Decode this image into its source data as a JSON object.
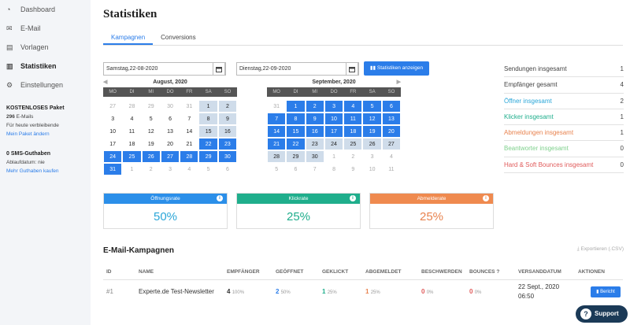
{
  "sidebar": {
    "items": [
      {
        "label": "Dashboard",
        "icon": "dashboard-icon"
      },
      {
        "label": "E-Mail",
        "icon": "email-icon"
      },
      {
        "label": "Vorlagen",
        "icon": "templates-icon"
      },
      {
        "label": "Statistiken",
        "icon": "chart-icon",
        "active": true
      },
      {
        "label": "Einstellungen",
        "icon": "gear-icon"
      }
    ],
    "package": {
      "head": "KOSTENLOSES Paket",
      "count": "296",
      "count_label": " E-Mails",
      "note": "Für heute verbleibende",
      "link": "Mein Paket ändern"
    },
    "sms": {
      "head": "0 SMS-Guthaben",
      "note": "Ablaufdatum: nie",
      "link": "Mehr Guthaben kaufen"
    }
  },
  "page": {
    "title": "Statistiken",
    "tabs": [
      "Kampagnen",
      "Conversions"
    ]
  },
  "filters": {
    "from": "Samstag,22-08-2020",
    "to": "Dienstag,22-09-2020",
    "button": "Statistiken anzeigen"
  },
  "calendars": [
    {
      "title": "August, 2020",
      "days": [
        [
          "27",
          "28",
          "29",
          "30",
          "31",
          "1",
          "2"
        ],
        [
          "3",
          "4",
          "5",
          "6",
          "7",
          "8",
          "9"
        ],
        [
          "10",
          "11",
          "12",
          "13",
          "14",
          "15",
          "16"
        ],
        [
          "17",
          "18",
          "19",
          "20",
          "21",
          "22",
          "23"
        ],
        [
          "24",
          "25",
          "26",
          "27",
          "28",
          "29",
          "30"
        ],
        [
          "31",
          "1",
          "2",
          "3",
          "4",
          "5",
          "6"
        ]
      ]
    },
    {
      "title": "September, 2020",
      "days": [
        [
          "31",
          "1",
          "2",
          "3",
          "4",
          "5",
          "6"
        ],
        [
          "7",
          "8",
          "9",
          "10",
          "11",
          "12",
          "13"
        ],
        [
          "14",
          "15",
          "16",
          "17",
          "18",
          "19",
          "20"
        ],
        [
          "21",
          "22",
          "23",
          "24",
          "25",
          "26",
          "27"
        ],
        [
          "28",
          "29",
          "30",
          "1",
          "2",
          "3",
          "4"
        ],
        [
          "5",
          "6",
          "7",
          "8",
          "9",
          "10",
          "11"
        ]
      ]
    }
  ],
  "weekdays": [
    "MO",
    "DI",
    "MI",
    "DO",
    "FR",
    "SA",
    "SO"
  ],
  "stats": [
    {
      "label": "Sendungen insgesamt",
      "value": "1",
      "color": "#444444"
    },
    {
      "label": "Empfänger gesamt",
      "value": "4",
      "color": "#444444"
    },
    {
      "label": "Öffner insgesamt",
      "value": "2",
      "color": "#2aa6d8"
    },
    {
      "label": "Klicker insgesamt",
      "value": "1",
      "color": "#1fae8c"
    },
    {
      "label": "Abmeldungen insgesamt",
      "value": "1",
      "color": "#e8834f"
    },
    {
      "label": "Beantworter insgesamt",
      "value": "0",
      "color": "#7ed08c"
    },
    {
      "label": "Hard & Soft Bounces insgesamt",
      "value": "0",
      "color": "#e05a5a"
    }
  ],
  "cards": [
    {
      "label": "Öffnungsrate",
      "value": "50%",
      "color": "#2b8fe9",
      "text": "#2aa6d8"
    },
    {
      "label": "Klickrate",
      "value": "25%",
      "color": "#1fae8c",
      "text": "#1fae8c"
    },
    {
      "label": "Abmelderate",
      "value": "25%",
      "color": "#ef8a4f",
      "text": "#e8834f"
    }
  ],
  "campaigns": {
    "title": "E-Mail-Kampagnen",
    "export": "Exportieren (.CSV)",
    "columns": [
      "ID",
      "NAME",
      "EMPFÄNGER",
      "GEÖFFNET",
      "GEKLICKT",
      "ABGEMELDET",
      "BESCHWERDEN",
      "BOUNCES",
      "VERSANDDATUM",
      "AKTIONEN"
    ],
    "rows": [
      {
        "id": "#1",
        "name": "Experte.de Test-Newsletter",
        "recipients": "4",
        "recipients_pct": "100%",
        "opened": "2",
        "opened_pct": "50%",
        "clicked": "1",
        "clicked_pct": "25%",
        "unsub": "1",
        "unsub_pct": "25%",
        "complaints": "0",
        "complaints_pct": "0%",
        "bounces": "0",
        "bounces_pct": "0%",
        "date": "22 Sept., 2020",
        "time": "06:50",
        "action": "Bericht"
      }
    ]
  },
  "support": "Support"
}
